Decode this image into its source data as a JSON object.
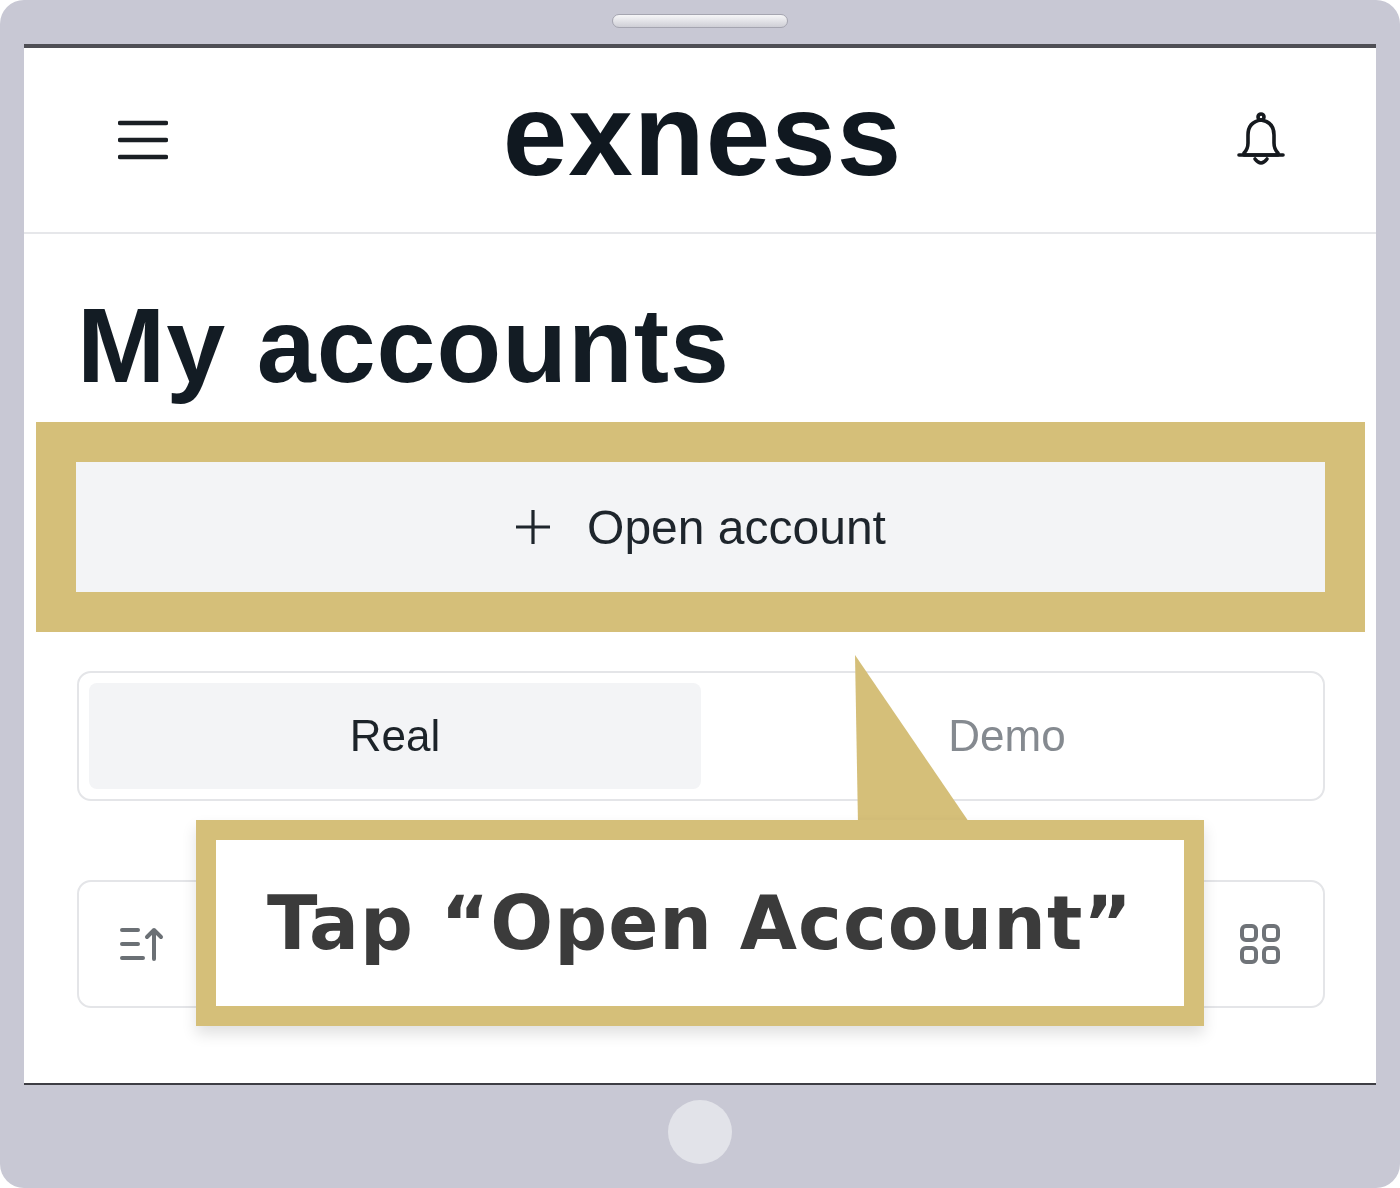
{
  "header": {
    "logo": "exness"
  },
  "title": "My accounts",
  "open_account_button": {
    "label": "Open account",
    "highlighted": true
  },
  "tabs": [
    {
      "label": "Real",
      "selected": true
    },
    {
      "label": "Demo",
      "selected": false
    }
  ],
  "callout": {
    "text": "Tap “Open Account”"
  }
}
